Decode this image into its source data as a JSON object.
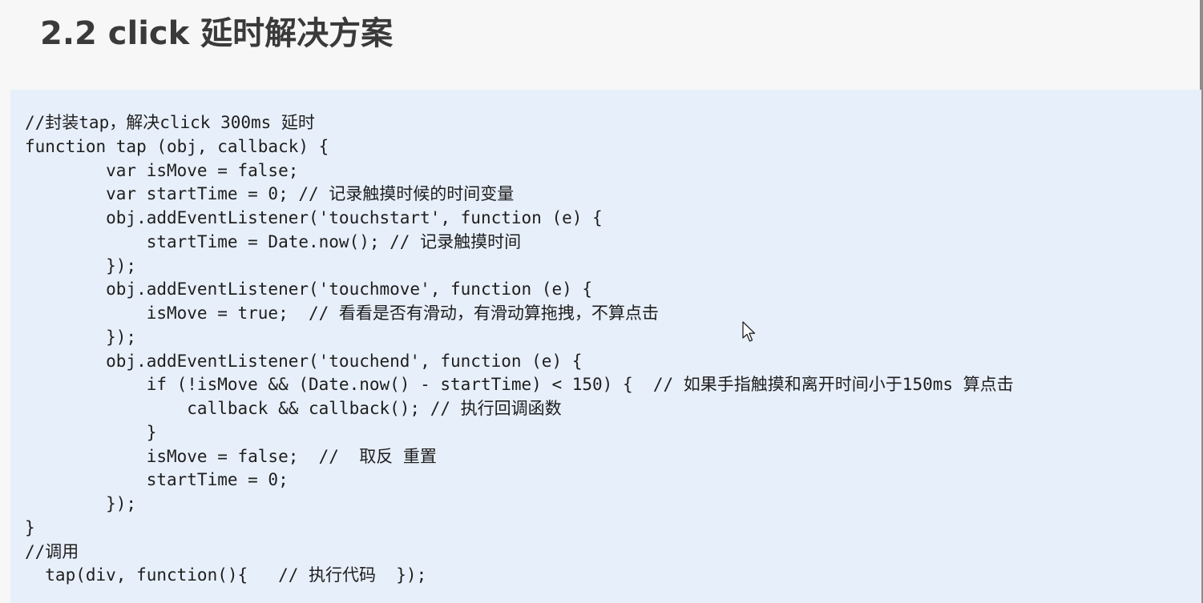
{
  "slide": {
    "title": "2.2 click 延时解决方案"
  },
  "code": {
    "lines": [
      "//封装tap，解决click 300ms 延时",
      "function tap (obj, callback) {",
      "        var isMove = false;",
      "        var startTime = 0; // 记录触摸时候的时间变量",
      "        obj.addEventListener('touchstart', function (e) {",
      "            startTime = Date.now(); // 记录触摸时间",
      "        });",
      "        obj.addEventListener('touchmove', function (e) {",
      "            isMove = true;  // 看看是否有滑动，有滑动算拖拽，不算点击",
      "        });",
      "        obj.addEventListener('touchend', function (e) {",
      "            if (!isMove && (Date.now() - startTime) < 150) {  // 如果手指触摸和离开时间小于150ms 算点击",
      "                callback && callback(); // 执行回调函数",
      "            }",
      "            isMove = false;  //  取反 重置",
      "            startTime = 0;",
      "        });",
      "}",
      "//调用",
      "  tap(div, function(){   // 执行代码  });"
    ]
  },
  "icons": {
    "cursor": "mouse-pointer-icon"
  }
}
